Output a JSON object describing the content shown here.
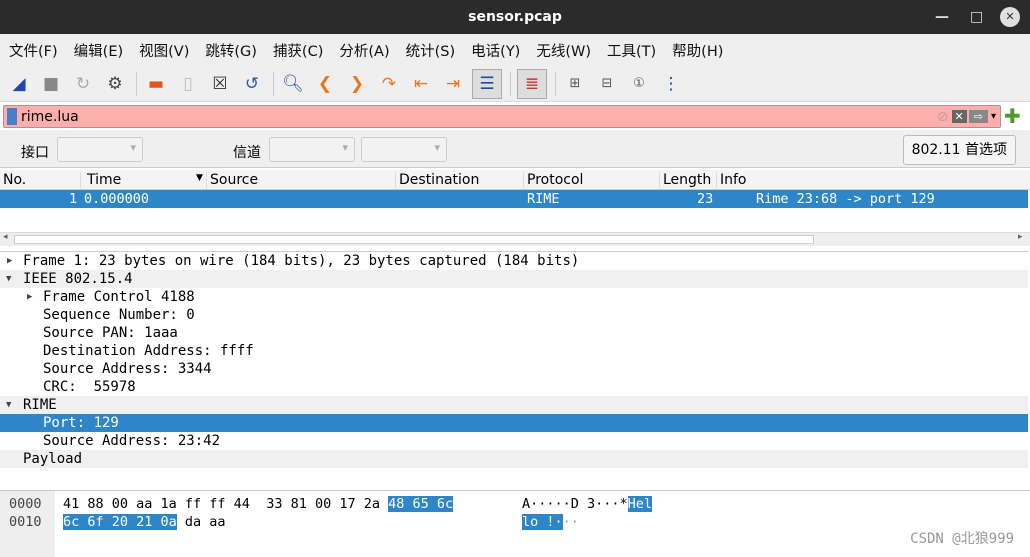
{
  "window": {
    "title": "sensor.pcap",
    "min": "—",
    "max": "□",
    "close": "✕"
  },
  "menu": [
    "文件(F)",
    "编辑(E)",
    "视图(V)",
    "跳转(G)",
    "捕获(C)",
    "分析(A)",
    "统计(S)",
    "电话(Y)",
    "无线(W)",
    "工具(T)",
    "帮助(H)"
  ],
  "toolbar": [
    "shark-fin-icon",
    "stop-icon",
    "restart-icon",
    "options-gear-icon",
    "open-folder-icon",
    "file-icon",
    "close-file-icon",
    "reload-icon",
    "find-icon",
    "back-icon",
    "forward-icon",
    "goto-icon",
    "first-icon",
    "last-icon",
    "autoscroll-icon",
    "colorize-icon",
    "zoom-in-icon",
    "zoom-out-icon",
    "normal-size-icon",
    "resize-columns-icon"
  ],
  "filter": {
    "value": "rime.lua"
  },
  "wireless": {
    "interface_label": "接口",
    "channel_label": "信道",
    "prefs_button": "802.11 首选项"
  },
  "packet_list": {
    "columns": [
      "No.",
      "Time",
      "Source",
      "Destination",
      "Protocol",
      "Length",
      "Info"
    ],
    "rows": [
      {
        "no": "1",
        "time": "0.000000",
        "source": "",
        "destination": "",
        "protocol": "RIME",
        "length": "23",
        "info": "Rime 23:68 -> port 129"
      }
    ]
  },
  "details": [
    "Frame 1: 23 bytes on wire (184 bits), 23 bytes captured (184 bits)",
    "IEEE 802.15.4",
    "Frame Control 4188",
    "Sequence Number: 0",
    "Source PAN: 1aaa",
    "Destination Address: ffff",
    "Source Address: 3344",
    "CRC:  55978",
    "RIME",
    "Port: 129",
    "Source Address: 23:42",
    "Payload"
  ],
  "hex": {
    "offsets": [
      "0000",
      "0010"
    ],
    "line1_plain": "41 88 00 aa 1a ff ff 44  33 81 00 17 2a ",
    "line1_hl": "48 65 6c",
    "line2_hl": "6c 6f 20 21 0a",
    "line2_plain": " da aa",
    "ascii1_plain": "A·····D 3···*",
    "ascii1_hl": "Hel",
    "ascii2_hl": "lo !·",
    "ascii2_plain": "··"
  },
  "watermark": "CSDN @北狼999",
  "colors": {
    "selection": "#2e86c8",
    "filter_bg": "#ffaeae",
    "titlebar": "#2b2b2b"
  }
}
